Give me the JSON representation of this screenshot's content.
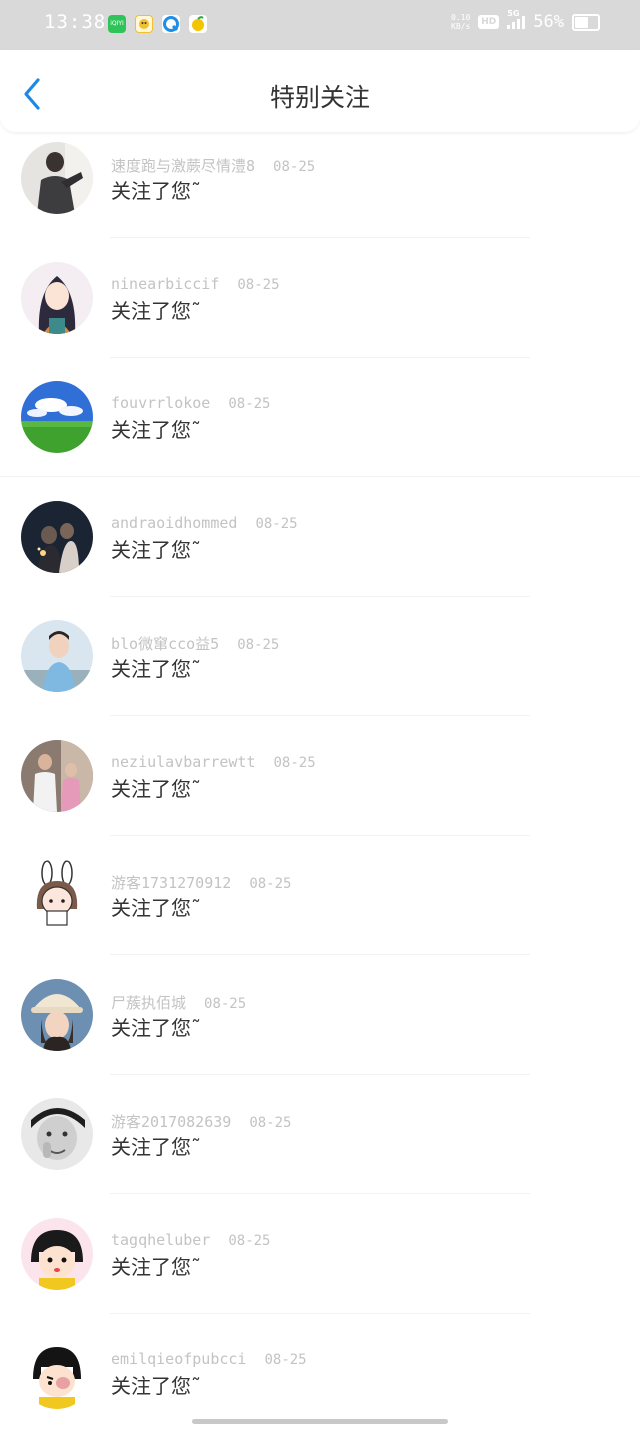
{
  "status_bar": {
    "time": "13:38",
    "net_speed_top": "0.10",
    "net_speed_unit": "KB/s",
    "hd": "HD",
    "network": "5G",
    "battery_pct": "56%",
    "battery_level": 0.56,
    "app_icons": [
      {
        "name": "iqiyi-icon",
        "color": "#2fc45a",
        "label": "iQIYI"
      },
      {
        "name": "cartoon-app-icon",
        "color": "#f0c030",
        "label": ""
      },
      {
        "name": "browser-icon",
        "color": "#1e8fe8",
        "label": ""
      },
      {
        "name": "fruit-app-icon",
        "color": "#f5c400",
        "label": ""
      }
    ]
  },
  "nav": {
    "back_icon": "chevron-left-icon",
    "title": "特别关注"
  },
  "colors": {
    "accent": "#1e88e5",
    "muted_text": "#c3c3c3",
    "primary_text": "#333333"
  },
  "notifications": [
    {
      "username": "速度跑与激蕨尽情澧8",
      "date": "08-25",
      "message": "关注了您˜",
      "avatar": "photo-person-dark-avatar"
    },
    {
      "username": "ninearbiccif",
      "date": "08-25",
      "message": "关注了您˜",
      "avatar": "anime-girl-avatar"
    },
    {
      "username": "fouvrrlokoe",
      "date": "08-25",
      "message": "关注了您˜",
      "avatar": "landscape-sky-grass-avatar"
    },
    {
      "username": "andraoidhommed",
      "date": "08-25",
      "message": "关注了您˜",
      "avatar": "photo-couple-night-avatar"
    },
    {
      "username": "blo微窜cco益5",
      "date": "08-25",
      "message": "关注了您˜",
      "avatar": "photo-boy-avatar"
    },
    {
      "username": "neziulavbarrewtt",
      "date": "08-25",
      "message": "关注了您˜",
      "avatar": "photo-couple-street-avatar"
    },
    {
      "username": "游客1731270912",
      "date": "08-25",
      "message": "关注了您˜",
      "avatar": "cartoon-bunny-girl-avatar"
    },
    {
      "username": "尸蔟执佰城",
      "date": "08-25",
      "message": "关注了您˜",
      "avatar": "photo-girl-bucket-hat-avatar"
    },
    {
      "username": "游客2017082639",
      "date": "08-25",
      "message": "关注了您˜",
      "avatar": "photo-grayscale-boy-avatar"
    },
    {
      "username": "tagqheluber",
      "date": "08-25",
      "message": "关注了您˜",
      "avatar": "cartoon-maruko-avatar"
    },
    {
      "username": "emilqieofpubcci",
      "date": "08-25",
      "message": "关注了您˜",
      "avatar": "cartoon-maruko-cheek-avatar"
    }
  ]
}
